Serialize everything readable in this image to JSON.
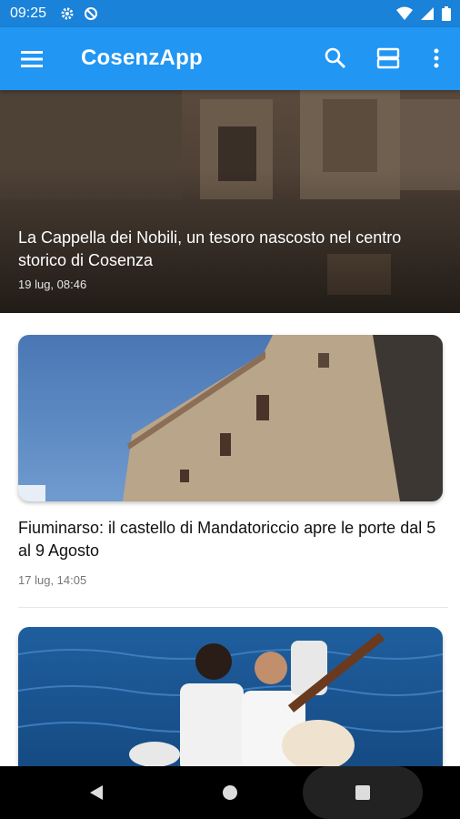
{
  "status_bar": {
    "time": "09:25"
  },
  "app_bar": {
    "title": "CosenzApp"
  },
  "hero": {
    "title": "La Cappella dei Nobili, un tesoro nascosto nel centro storico di Cosenza",
    "date": "19 lug, 08:46"
  },
  "articles": [
    {
      "title": "Fiuminarso: il castello di Mandatoriccio apre le porte dal 5 al 9 Agosto",
      "date": "17 lug, 14:05"
    }
  ],
  "colors": {
    "status_bar": "#1a82d8",
    "app_bar": "#2196f3"
  }
}
